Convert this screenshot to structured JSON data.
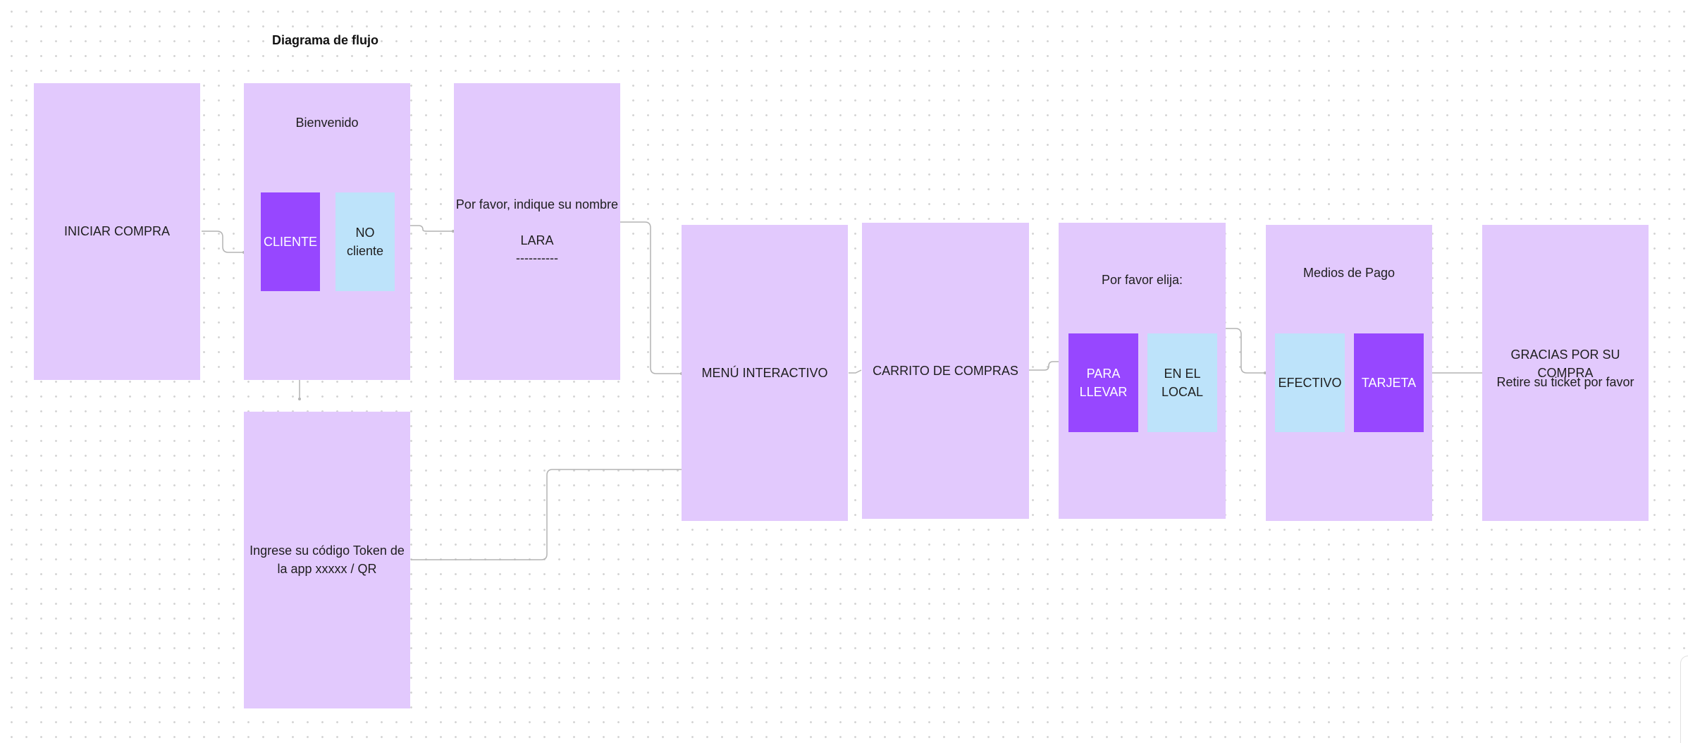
{
  "diagram": {
    "title": "Diagrama de flujo",
    "colors": {
      "frame": "#e2c9fd",
      "accent_purple": "#9747ff",
      "accent_blue": "#bde3fa",
      "connector": "#b3b3b3"
    },
    "steps": {
      "iniciar": {
        "label": "INICIAR COMPRA"
      },
      "bienvenido": {
        "heading": "Bienvenido",
        "option_cliente": "CLIENTE",
        "option_no_cliente": "NO\ncliente"
      },
      "nombre": {
        "prompt": "Por favor, indique su nombre",
        "value": "LARA",
        "underline": "----------"
      },
      "token": {
        "prompt": "Ingrese su código Token de\nla app xxxxx / QR"
      },
      "menu": {
        "label": "MENÚ INTERACTIVO"
      },
      "carrito": {
        "label": "CARRITO DE COMPRAS"
      },
      "eleccion": {
        "heading": "Por favor elija:",
        "option_llevar": "PARA\nLLEVAR",
        "option_local": "EN EL\nLOCAL"
      },
      "pago": {
        "heading": "Medios de Pago",
        "option_efectivo": "EFECTIVO",
        "option_tarjeta": "TARJETA"
      },
      "gracias": {
        "line1": "GRACIAS POR SU COMPRA",
        "line2": "Retire su ticket por favor"
      }
    }
  }
}
